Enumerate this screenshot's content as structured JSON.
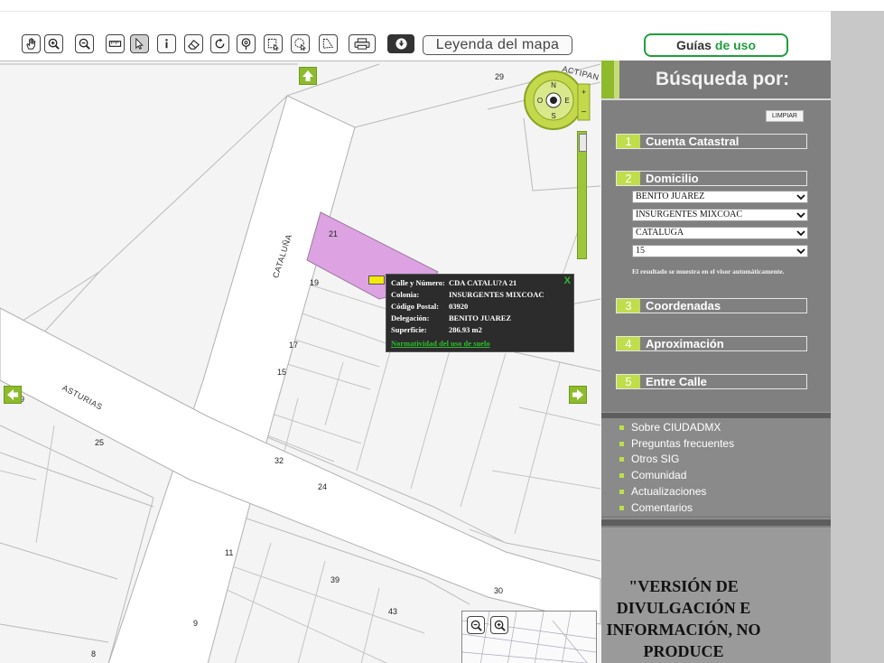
{
  "toolbar": {
    "tools": [
      "pan-icon",
      "zoom-in-icon",
      "zoom-out-icon",
      "measure-ruler-icon",
      "select-pointer-icon",
      "info-icon",
      "eraser-icon",
      "refresh-icon",
      "location-search-icon",
      "select-rectangle-icon",
      "select-circle-icon",
      "select-polygon-icon",
      "print-icon",
      "download-icon"
    ],
    "legend_label": "Leyenda del mapa"
  },
  "guides": {
    "part1": "Guías",
    "part2": "de uso"
  },
  "map": {
    "parcel_numbers": [
      "29",
      "21",
      "19",
      "17",
      "15",
      "25",
      "32",
      "24",
      "11",
      "39",
      "30",
      "43",
      "9",
      "8",
      "9"
    ],
    "streets": {
      "cataluna": "CATALUÑA",
      "asturias": "ASTURIAS",
      "actipan": "ACTIPAN"
    },
    "compass": {
      "n": "N",
      "s": "S",
      "e": "E",
      "o": "O"
    },
    "popup": {
      "rows": [
        {
          "key": "Calle y Número:",
          "value": "CDA CATALU?A 21"
        },
        {
          "key": "Colonia:",
          "value": "INSURGENTES MIXCOAC"
        },
        {
          "key": "Código Postal:",
          "value": "03920"
        },
        {
          "key": "Delegación:",
          "value": "BENITO JUAREZ"
        },
        {
          "key": "Superficie:",
          "value": "286.93 m2"
        }
      ],
      "link": "Normatividad del uso de suelo",
      "close": "X"
    },
    "colors": {
      "selected_parcel": "#dda2e2",
      "accent": "#8dbb2c"
    }
  },
  "panel": {
    "title": "Búsqueda por:",
    "clear": "LIMPIAR",
    "sections": [
      {
        "num": "1",
        "label": "Cuenta Catastral"
      },
      {
        "num": "2",
        "label": "Domicilio"
      },
      {
        "num": "3",
        "label": "Coordenadas"
      },
      {
        "num": "4",
        "label": "Aproximación"
      },
      {
        "num": "5",
        "label": "Entre Calle"
      }
    ],
    "selects": [
      "BENITO JUAREZ",
      "INSURGENTES MIXCOAC",
      "CATALUGA",
      "15"
    ],
    "hint": "El resultado se muestra en el visor automáticamente.",
    "links": [
      "Sobre CIUDADMX",
      "Preguntas frecuentes",
      "Otros SIG",
      "Comunidad",
      "Actualizaciones",
      "Comentarios"
    ],
    "notice": "\"VERSIÓN DE DIVULGACIÓN E INFORMACIÓN, NO PRODUCE"
  }
}
